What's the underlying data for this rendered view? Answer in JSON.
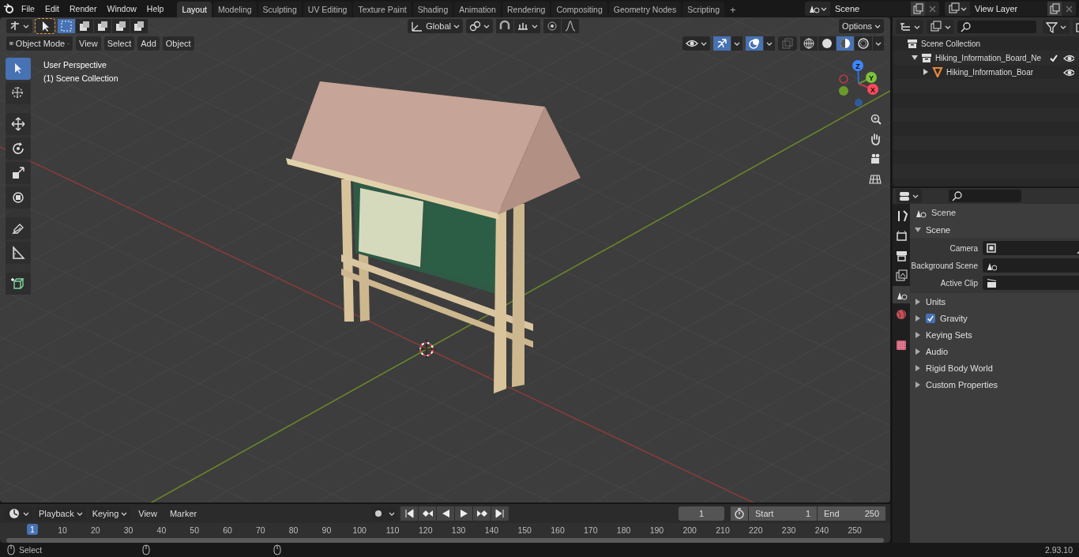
{
  "menu": [
    "File",
    "Edit",
    "Render",
    "Window",
    "Help"
  ],
  "workspaces": [
    {
      "label": "Layout",
      "selected": true
    },
    {
      "label": "Modeling",
      "selected": false
    },
    {
      "label": "Sculpting",
      "selected": false
    },
    {
      "label": "UV Editing",
      "selected": false
    },
    {
      "label": "Texture Paint",
      "selected": false
    },
    {
      "label": "Shading",
      "selected": false
    },
    {
      "label": "Animation",
      "selected": false
    },
    {
      "label": "Rendering",
      "selected": false
    },
    {
      "label": "Compositing",
      "selected": false
    },
    {
      "label": "Geometry Nodes",
      "selected": false
    },
    {
      "label": "Scripting",
      "selected": false
    }
  ],
  "add_workspace": "+",
  "scene": {
    "value": "Scene"
  },
  "view_layer": {
    "value": "View Layer"
  },
  "viewport": {
    "select_modes": [
      {
        "selected": true
      },
      {
        "selected": false
      },
      {
        "selected": false
      },
      {
        "selected": false
      },
      {
        "selected": false
      }
    ],
    "orientation": "Global",
    "options": "Options",
    "mode": "Object Mode",
    "menus": [
      "View",
      "Select",
      "Add",
      "Object"
    ],
    "gizmos_on": true,
    "overlays_on": true,
    "shading": [
      {
        "selected": false
      },
      {
        "selected": false
      },
      {
        "selected": true
      },
      {
        "selected": false
      }
    ],
    "overlay_texts": [
      "User Perspective",
      "(1) Scene Collection"
    ],
    "tools": [
      {
        "selected": true
      },
      {
        "selected": false
      },
      {
        "selected": false
      },
      {
        "selected": false
      },
      {
        "selected": false
      },
      {
        "selected": false
      },
      {
        "selected": false
      },
      {
        "selected": false
      },
      {
        "selected": false
      }
    ],
    "axes": [
      "Z",
      "Y",
      "X"
    ]
  },
  "outliner": {
    "root": "Scene Collection",
    "items": [
      {
        "name": "Hiking_Information_Board_Ne",
        "expanded": true,
        "checked": true,
        "children": [
          {
            "name": "Hiking_Information_Boar",
            "expanded": false
          }
        ]
      }
    ]
  },
  "properties": {
    "tabs": [
      {
        "selected": false
      },
      {
        "selected": false
      },
      {
        "selected": false
      },
      {
        "selected": false
      },
      {
        "selected": true
      },
      {
        "selected": false
      },
      {
        "selected": false
      }
    ],
    "context": "Scene",
    "panel": {
      "title": "Scene",
      "expanded": true,
      "fields": [
        {
          "label": "Camera"
        },
        {
          "label": "Background Scene"
        },
        {
          "label": "Active Clip"
        }
      ]
    },
    "sections": [
      {
        "title": "Units",
        "kind": "plain"
      },
      {
        "title": "Gravity",
        "kind": "toggle",
        "checked": true
      },
      {
        "title": "Keying Sets",
        "kind": "plain"
      },
      {
        "title": "Audio",
        "kind": "plain"
      },
      {
        "title": "Rigid Body World",
        "kind": "plain"
      },
      {
        "title": "Custom Properties",
        "kind": "plain"
      }
    ]
  },
  "timeline": {
    "menus": [
      "Playback",
      "Keying",
      "View",
      "Marker"
    ],
    "current_frame": "1",
    "start_label": "Start",
    "start": "1",
    "end_label": "End",
    "end": "250",
    "ticks": [
      {
        "label": "1",
        "selected": true
      },
      {
        "label": "10",
        "selected": false
      },
      {
        "label": "20",
        "selected": false
      },
      {
        "label": "30",
        "selected": false
      },
      {
        "label": "40",
        "selected": false
      },
      {
        "label": "50",
        "selected": false
      },
      {
        "label": "60",
        "selected": false
      },
      {
        "label": "70",
        "selected": false
      },
      {
        "label": "80",
        "selected": false
      },
      {
        "label": "90",
        "selected": false
      },
      {
        "label": "100",
        "selected": false
      },
      {
        "label": "110",
        "selected": false
      },
      {
        "label": "120",
        "selected": false
      },
      {
        "label": "130",
        "selected": false
      },
      {
        "label": "140",
        "selected": false
      },
      {
        "label": "150",
        "selected": false
      },
      {
        "label": "160",
        "selected": false
      },
      {
        "label": "170",
        "selected": false
      },
      {
        "label": "180",
        "selected": false
      },
      {
        "label": "190",
        "selected": false
      },
      {
        "label": "200",
        "selected": false
      },
      {
        "label": "210",
        "selected": false
      },
      {
        "label": "220",
        "selected": false
      },
      {
        "label": "230",
        "selected": false
      },
      {
        "label": "240",
        "selected": false
      },
      {
        "label": "250",
        "selected": false
      }
    ]
  },
  "status_bar": {
    "hint": "Select",
    "version": "2.93.10"
  }
}
